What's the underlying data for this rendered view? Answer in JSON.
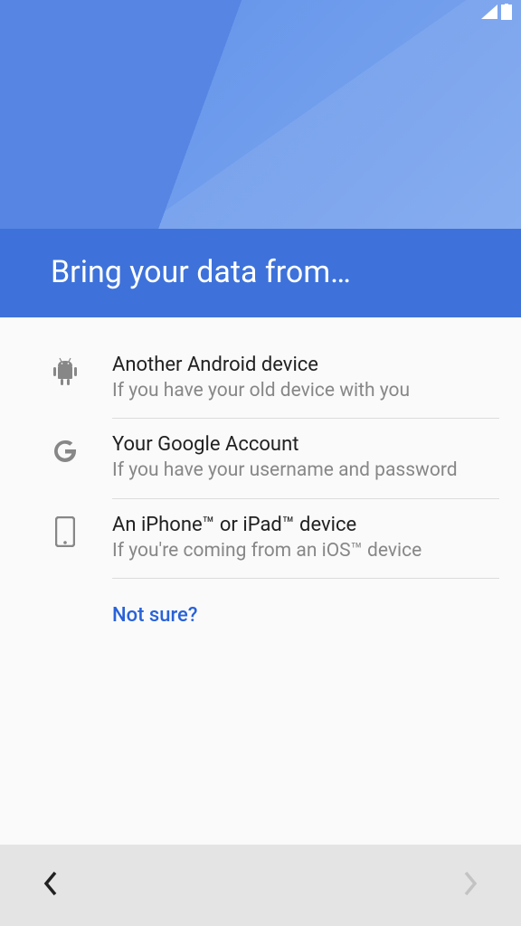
{
  "header": {
    "title": "Bring your data from…"
  },
  "options": [
    {
      "title": "Another Android device",
      "subtitle": "If you have your old device with you",
      "icon": "android"
    },
    {
      "title": "Your Google Account",
      "subtitle": "If you have your username and password",
      "icon": "google"
    },
    {
      "title": "An iPhone™ or iPad™ device",
      "subtitle": "If you're coming from an iOS™ device",
      "icon": "phone"
    }
  ],
  "not_sure_label": "Not sure?",
  "colors": {
    "accent": "#2962d9",
    "header_band": "#3e72da",
    "header_top": "#5c8ee8"
  }
}
